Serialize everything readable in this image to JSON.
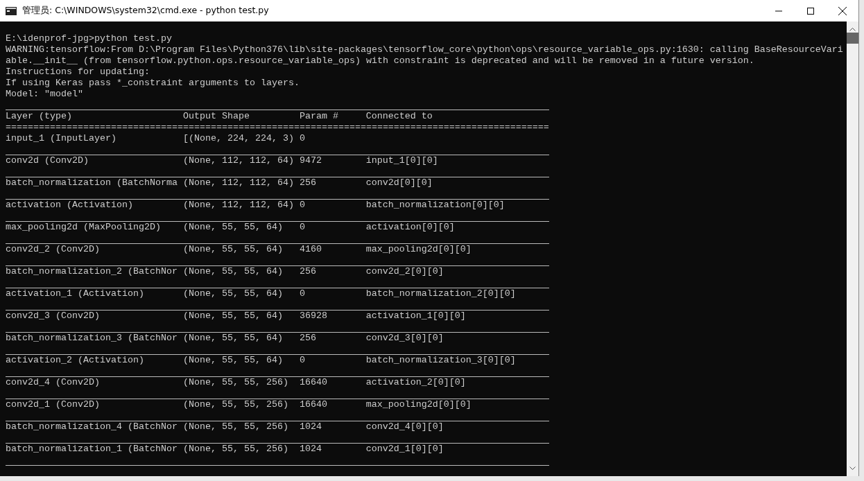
{
  "window": {
    "title": "管理员: C:\\WINDOWS\\system32\\cmd.exe - python  test.py"
  },
  "console_lines": [
    "E:\\idenprof-jpg>python test.py",
    "WARNING:tensorflow:From D:\\Program Files\\Python376\\lib\\site-packages\\tensorflow_core\\python\\ops\\resource_variable_ops.py:1630: calling BaseResourceVari",
    "able.__init__ (from tensorflow.python.ops.resource_variable_ops) with constraint is deprecated and will be removed in a future version.",
    "Instructions for updating:",
    "If using Keras pass *_constraint arguments to layers.",
    "Model: \"model\""
  ],
  "table": {
    "columns": [
      "Layer (type)",
      "Output Shape",
      "Param #",
      "Connected to"
    ],
    "separator": "==================================================================================================",
    "rows": [
      [
        "input_1 (InputLayer)",
        "[(None, 224, 224, 3)",
        "0",
        ""
      ],
      [
        "conv2d (Conv2D)",
        "(None, 112, 112, 64)",
        "9472",
        "input_1[0][0]"
      ],
      [
        "batch_normalization (BatchNorma",
        "(None, 112, 112, 64)",
        "256",
        "conv2d[0][0]"
      ],
      [
        "activation (Activation)",
        "(None, 112, 112, 64)",
        "0",
        "batch_normalization[0][0]"
      ],
      [
        "max_pooling2d (MaxPooling2D)",
        "(None, 55, 55, 64)",
        "0",
        "activation[0][0]"
      ],
      [
        "conv2d_2 (Conv2D)",
        "(None, 55, 55, 64)",
        "4160",
        "max_pooling2d[0][0]"
      ],
      [
        "batch_normalization_2 (BatchNor",
        "(None, 55, 55, 64)",
        "256",
        "conv2d_2[0][0]"
      ],
      [
        "activation_1 (Activation)",
        "(None, 55, 55, 64)",
        "0",
        "batch_normalization_2[0][0]"
      ],
      [
        "conv2d_3 (Conv2D)",
        "(None, 55, 55, 64)",
        "36928",
        "activation_1[0][0]"
      ],
      [
        "batch_normalization_3 (BatchNor",
        "(None, 55, 55, 64)",
        "256",
        "conv2d_3[0][0]"
      ],
      [
        "activation_2 (Activation)",
        "(None, 55, 55, 64)",
        "0",
        "batch_normalization_3[0][0]"
      ],
      [
        "conv2d_4 (Conv2D)",
        "(None, 55, 55, 256)",
        "16640",
        "activation_2[0][0]"
      ],
      [
        "conv2d_1 (Conv2D)",
        "(None, 55, 55, 256)",
        "16640",
        "max_pooling2d[0][0]"
      ],
      [
        "batch_normalization_4 (BatchNor",
        "(None, 55, 55, 256)",
        "1024",
        "conv2d_4[0][0]"
      ],
      [
        "batch_normalization_1 (BatchNor",
        "(None, 55, 55, 256)",
        "1024",
        "conv2d_1[0][0]"
      ]
    ]
  }
}
